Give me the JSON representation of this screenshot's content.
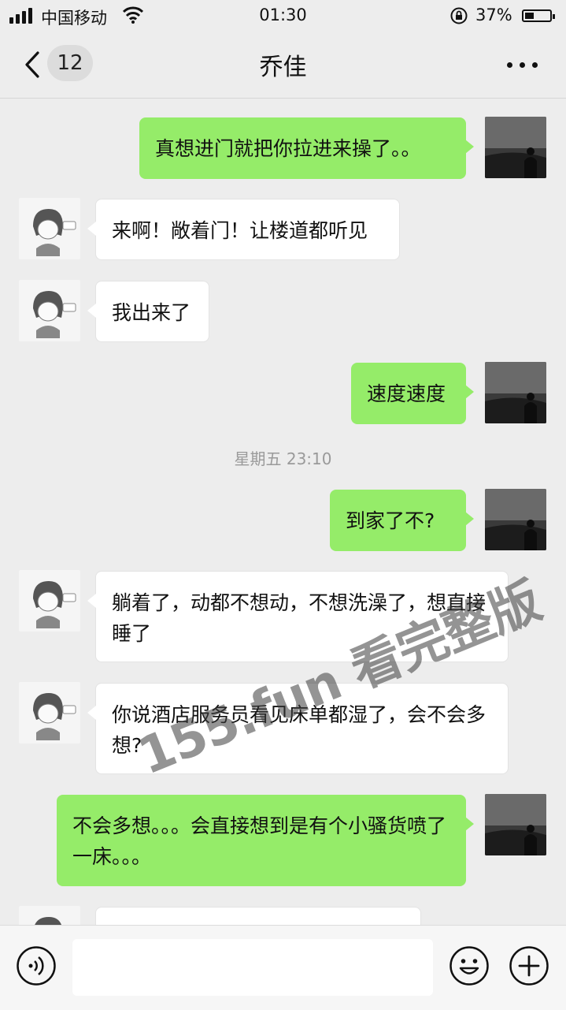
{
  "status_bar": {
    "carrier": "中国移动",
    "time": "01:30",
    "battery_percent": "37%",
    "battery_level": 0.37,
    "icons": [
      "signal-icon",
      "wifi-icon",
      "rotation-lock-icon",
      "battery-icon"
    ]
  },
  "nav": {
    "back_icon": "chevron-left-icon",
    "unread_count": "12",
    "title": "乔佳",
    "more_icon": "more-dots-icon"
  },
  "messages": [
    {
      "side": "out",
      "text": "真想进门就把你拉进来操了。。"
    },
    {
      "side": "in",
      "text": "来啊！敞着门！让楼道都听见"
    },
    {
      "side": "in",
      "text": "我出来了"
    },
    {
      "side": "out",
      "text": "速度速度"
    },
    {
      "side": "out",
      "text": "到家了不?"
    },
    {
      "side": "in",
      "text": "躺着了，动都不想动，不想洗澡了，想直接睡了"
    },
    {
      "side": "in",
      "text": "你说酒店服务员看见床单都湿了，会不会多想?"
    },
    {
      "side": "out",
      "text": "不会多想。。。会直接想到是有个小骚货喷了一床。。。"
    }
  ],
  "timestamp": "星期五 23:10",
  "watermark": "155.fun 看完整版",
  "input_bar": {
    "voice_icon": "voice-icon",
    "message_value": "",
    "emoji_icon": "emoji-icon",
    "add_icon": "plus-circle-icon"
  },
  "colors": {
    "background": "#ededed",
    "outgoing_bubble": "#95ec69",
    "incoming_bubble": "#ffffff"
  }
}
